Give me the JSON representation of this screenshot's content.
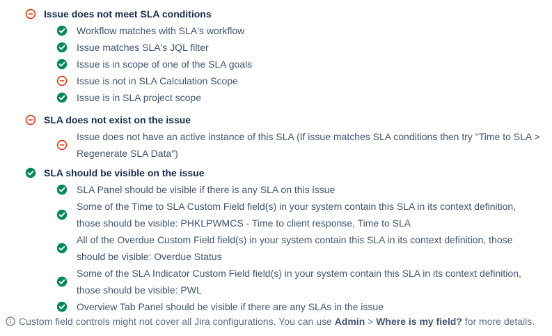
{
  "sections": [
    {
      "status": "error",
      "title": "Issue does not meet SLA conditions",
      "items": [
        {
          "status": "ok",
          "text": "Workflow matches with SLA's workflow"
        },
        {
          "status": "ok",
          "text": "Issue matches SLA's JQL filter"
        },
        {
          "status": "ok",
          "text": "Issue is in scope of one of the SLA goals"
        },
        {
          "status": "error",
          "text": "Issue is not in SLA Calculation Scope"
        },
        {
          "status": "ok",
          "text": "Issue is in SLA project scope"
        }
      ]
    },
    {
      "status": "error",
      "title": "SLA does not exist on the issue",
      "items": [
        {
          "status": "error",
          "text": "Issue does not have an active instance of this SLA (If issue matches SLA conditions then try \"Time to SLA > Regenerate SLA Data\")"
        }
      ]
    },
    {
      "status": "ok",
      "title": "SLA should be visible on the issue",
      "items": [
        {
          "status": "ok",
          "text": "SLA Panel should be visible if there is any SLA on this issue"
        },
        {
          "status": "ok",
          "text": "Some of the Time to SLA Custom Field field(s) in your system contain this SLA in its context definition, those should be visible: PHKLPWMCS - Time to client response, Time to SLA"
        },
        {
          "status": "ok",
          "text": "All of the Overdue Custom Field field(s) in your system contain this SLA in its context definition, those should be visible: Overdue Status"
        },
        {
          "status": "ok",
          "text": "Some of the SLA Indicator Custom Field field(s) in your system contain this SLA in its context definition, those should be visible: PWL"
        },
        {
          "status": "ok",
          "text": "Overview Tab Panel should be visible if there are any SLAs in the issue"
        }
      ]
    }
  ],
  "footer": {
    "icon": "info-icon",
    "text_before": "Custom field controls might not cover all Jira configurations. You can use ",
    "admin": "Admin",
    "sep": " > ",
    "where": "Where is my field?",
    "text_after": " for more details."
  },
  "colors": {
    "ok": "#00875a",
    "error": "#de350b",
    "heading": "#172b4d",
    "text": "#42526e",
    "muted": "#5e6c84"
  }
}
